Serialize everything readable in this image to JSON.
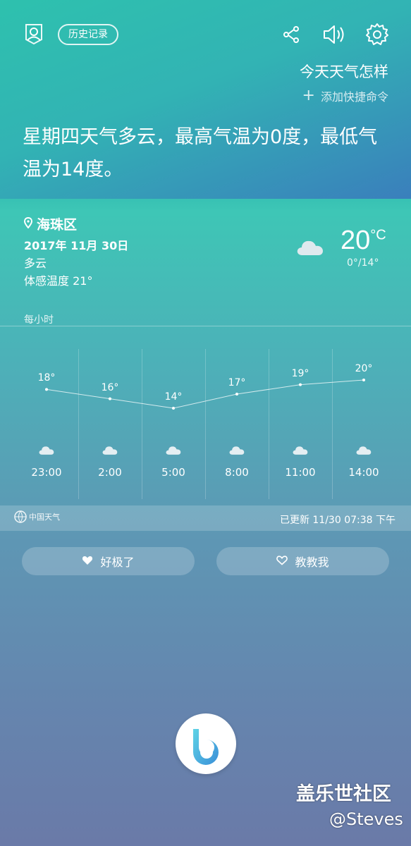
{
  "header": {
    "history_label": "历史记录",
    "query": "今天天气怎样",
    "add_shortcut": "添加快捷命令"
  },
  "answer": "星期四天气多云，最高气温为0度，最低气温为14度。",
  "weather": {
    "location": "海珠区",
    "date": "2017年 11月 30日",
    "condition": "多云",
    "feels_like": "体感温度 21°",
    "temp": "20",
    "temp_unit": "°C",
    "range": "0°/14°",
    "hourly_label": "每小时",
    "hourly": [
      {
        "time": "23:00",
        "temp": "18°",
        "value": 18
      },
      {
        "time": "2:00",
        "temp": "16°",
        "value": 16
      },
      {
        "time": "5:00",
        "temp": "14°",
        "value": 14
      },
      {
        "time": "8:00",
        "temp": "17°",
        "value": 17
      },
      {
        "time": "11:00",
        "temp": "19°",
        "value": 19
      },
      {
        "time": "14:00",
        "temp": "20°",
        "value": 20
      }
    ],
    "source": "中国天气",
    "updated": "已更新  11/30 07:38 下午"
  },
  "feedback": {
    "like": "好极了",
    "teach": "教教我"
  },
  "watermark": {
    "line1": "盖乐世社区",
    "line2": "@Steves"
  },
  "icons": [
    "profile-icon",
    "share-icon",
    "volume-icon",
    "settings-icon",
    "location-pin-icon",
    "cloud-icon",
    "heart-icon",
    "bixby-icon"
  ]
}
